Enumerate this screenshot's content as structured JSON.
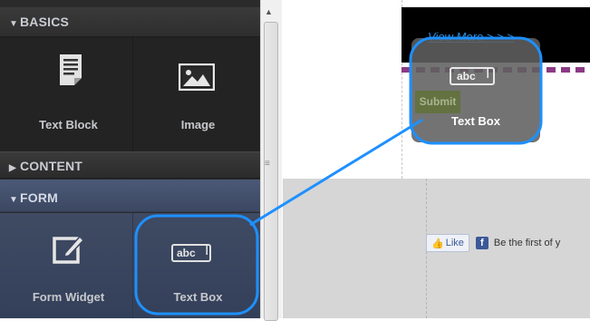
{
  "sidebar": {
    "basics": {
      "title": "BASICS",
      "items": [
        {
          "label": "Text Block",
          "icon": "text-block-icon"
        },
        {
          "label": "Image",
          "icon": "image-icon"
        }
      ]
    },
    "content": {
      "title": "CONTENT"
    },
    "form": {
      "title": "FORM",
      "items": [
        {
          "label": "Form Widget",
          "icon": "form-widget-icon"
        },
        {
          "label": "Text Box",
          "icon": "text-box-icon",
          "icon_text": "abc"
        }
      ]
    }
  },
  "canvas": {
    "view_more": "View More > > >",
    "like_label": "Like",
    "fb_text": "Be the first of y"
  },
  "drag_preview": {
    "icon_text": "abc",
    "submit_label": "Submit",
    "label": "Text Box"
  },
  "colors": {
    "highlight": "#1e90ff",
    "panel_bg": "#2b2b2b",
    "form_bg": "#3f4a63"
  }
}
